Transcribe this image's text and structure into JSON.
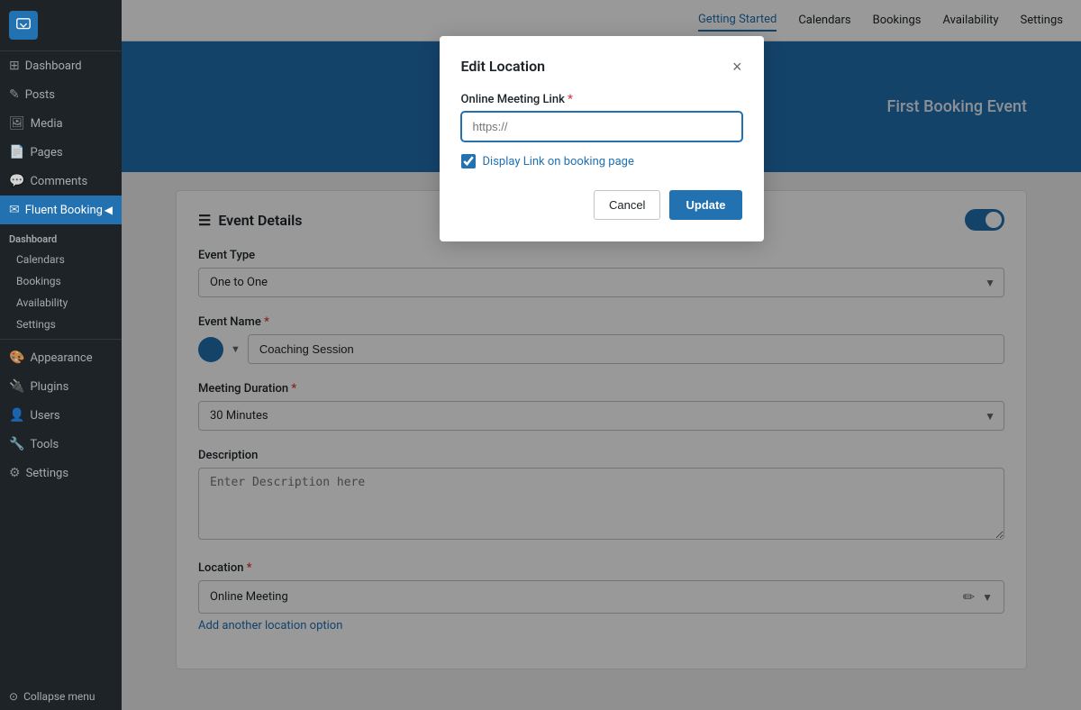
{
  "sidebar": {
    "items": [
      {
        "label": "Dashboard",
        "icon": "⊞",
        "active": false
      },
      {
        "label": "Posts",
        "icon": "✎",
        "active": false
      },
      {
        "label": "Media",
        "icon": "🖼",
        "active": false
      },
      {
        "label": "Pages",
        "icon": "📄",
        "active": false
      },
      {
        "label": "Comments",
        "icon": "💬",
        "active": false
      },
      {
        "label": "Fluent Booking",
        "icon": "✉",
        "active": true
      }
    ],
    "sub_items": [
      {
        "label": "Dashboard"
      },
      {
        "label": "Calendars"
      },
      {
        "label": "Bookings"
      },
      {
        "label": "Availability"
      },
      {
        "label": "Settings"
      }
    ],
    "other_items": [
      {
        "label": "Appearance",
        "icon": "🎨"
      },
      {
        "label": "Plugins",
        "icon": "🔌"
      },
      {
        "label": "Users",
        "icon": "👤"
      },
      {
        "label": "Tools",
        "icon": "🔧"
      },
      {
        "label": "Settings",
        "icon": "⚙"
      }
    ],
    "collapse_label": "Collapse menu"
  },
  "topnav": {
    "links": [
      {
        "label": "Getting Started",
        "active": true
      },
      {
        "label": "Calendars",
        "active": false
      },
      {
        "label": "Bookings",
        "active": false
      },
      {
        "label": "Availability",
        "active": false
      },
      {
        "label": "Settings",
        "active": false
      }
    ]
  },
  "banner": {
    "text": "First Booking Event"
  },
  "event_details": {
    "title": "Event Details",
    "event_type_label": "Event Type",
    "event_type_value": "One to One",
    "event_name_label": "Event Name",
    "required_marker": "*",
    "event_name_value": "Coaching Session",
    "duration_label": "Meeting Duration",
    "duration_value": "30 Minutes",
    "description_label": "Description",
    "description_placeholder": "Enter Description here",
    "location_label": "Location",
    "location_value": "Online Meeting",
    "add_location_label": "Add another location option"
  },
  "modal": {
    "title": "Edit Location",
    "close_icon": "×",
    "field_label": "Online Meeting Link",
    "required_marker": "*",
    "input_placeholder": "https://",
    "checkbox_label": "Display Link on booking page",
    "checkbox_checked": true,
    "cancel_label": "Cancel",
    "update_label": "Update"
  },
  "colors": {
    "primary": "#2271b1",
    "accent": "#2271b1",
    "sidebar_bg": "#1e2327",
    "active_bg": "#2271b1"
  }
}
